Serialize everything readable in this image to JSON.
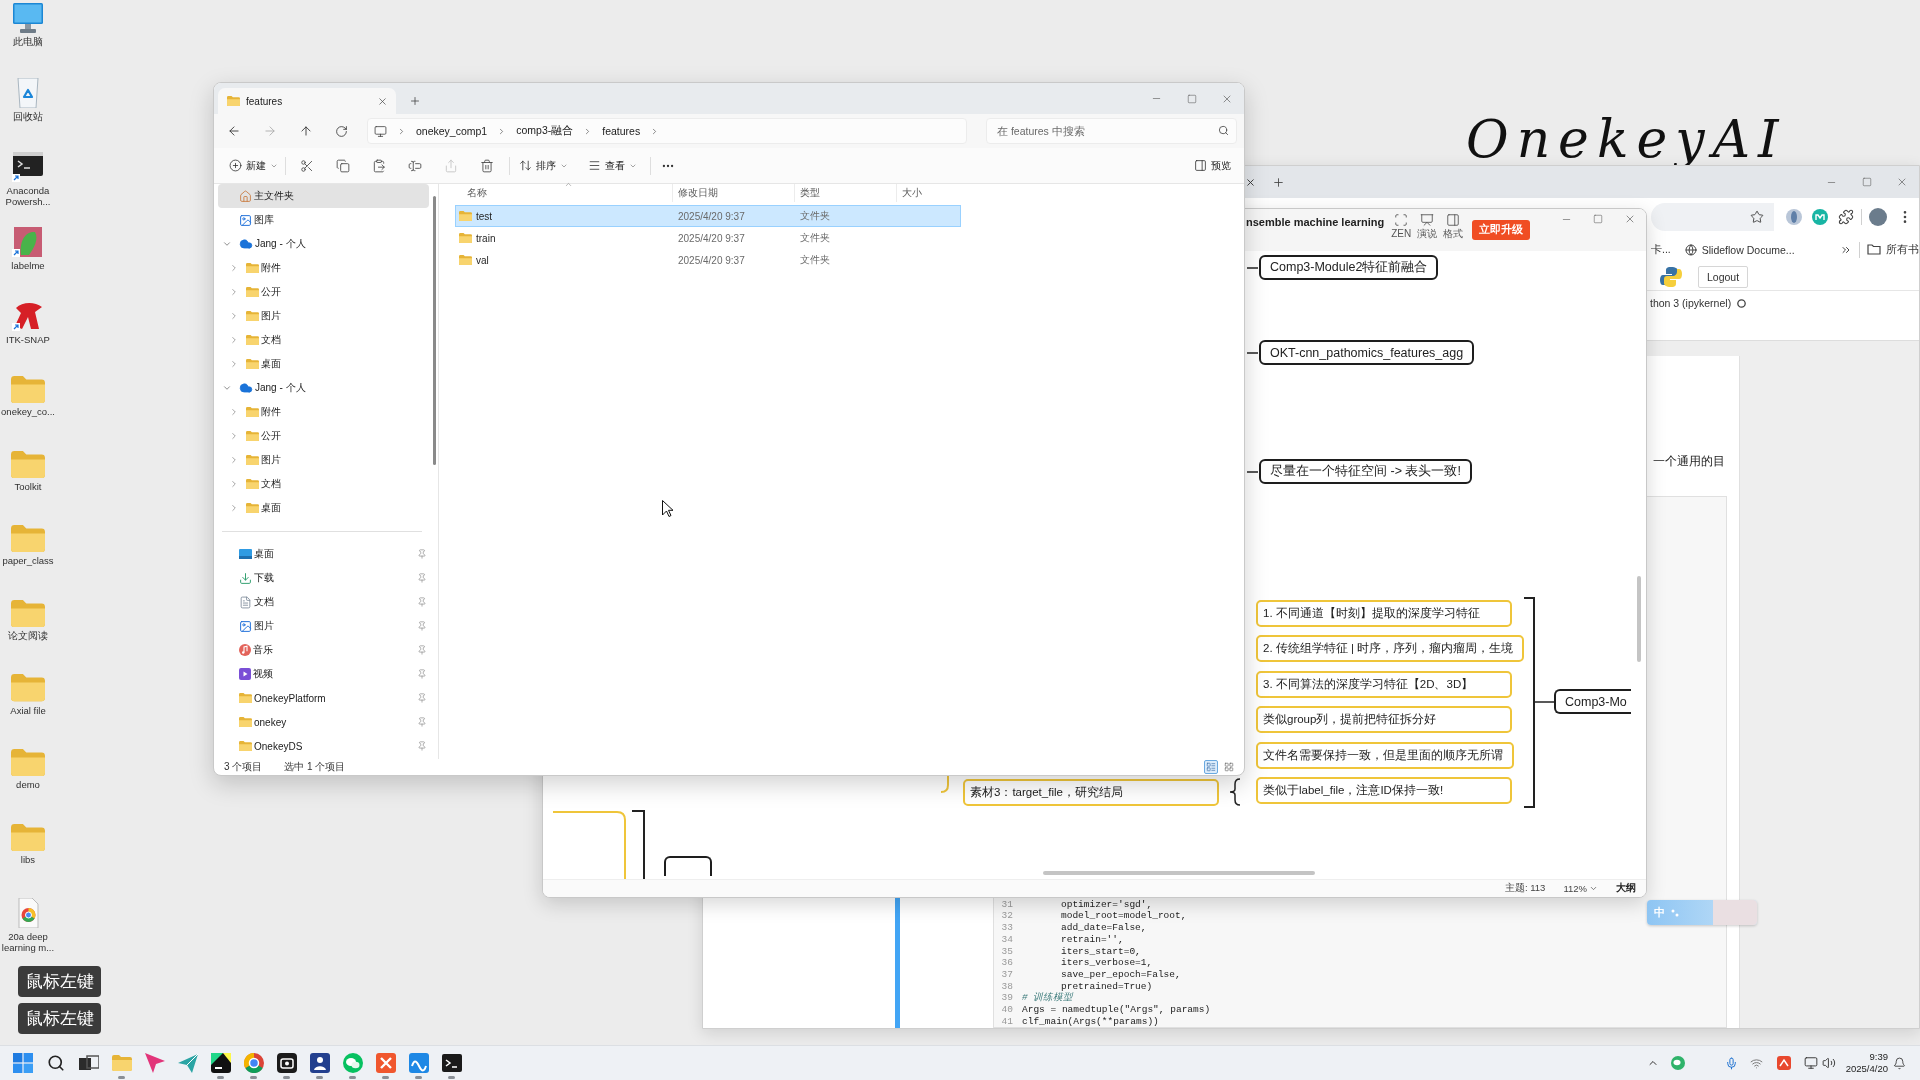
{
  "desktop": {
    "background_logo": "OnekeyAI",
    "icons": [
      {
        "label": "此电脑",
        "kind": "computer"
      },
      {
        "label": "回收站",
        "kind": "recycle"
      },
      {
        "label": "Anaconda Powersh...",
        "kind": "terminal"
      },
      {
        "label": "labelme",
        "kind": "labelme"
      },
      {
        "label": "ITK-SNAP",
        "kind": "snap"
      },
      {
        "label": "onekey_co...",
        "kind": "folder"
      },
      {
        "label": "Toolkit",
        "kind": "folder"
      },
      {
        "label": "paper_class",
        "kind": "folder"
      },
      {
        "label": "论文阅读",
        "kind": "folder"
      },
      {
        "label": "Axial file",
        "kind": "folder"
      },
      {
        "label": "demo",
        "kind": "folder"
      },
      {
        "label": "libs",
        "kind": "folder"
      },
      {
        "label": "20a deep learning m...",
        "kind": "pdf"
      }
    ],
    "key_captions": [
      "鼠标左键",
      "鼠标左键"
    ]
  },
  "explorer": {
    "tabs": [
      {
        "title": "features",
        "selected": true
      }
    ],
    "breadcrumbs": [
      "onekey_comp1",
      "comp3-融合",
      "features"
    ],
    "search_placeholder": "在 features 中搜索",
    "toolbar": {
      "new": "新建",
      "actions": [
        {
          "kind": "cut",
          "disabled": false
        },
        {
          "kind": "copy",
          "disabled": false
        },
        {
          "kind": "paste",
          "disabled": false
        },
        {
          "kind": "rename",
          "disabled": false
        },
        {
          "kind": "share",
          "disabled": true
        },
        {
          "kind": "delete",
          "disabled": false
        }
      ],
      "sort": "排序",
      "view": "查看",
      "preview": "预览"
    },
    "sidebar": {
      "items": [
        {
          "label": "主文件夹",
          "kind": "home",
          "selected": true
        },
        {
          "label": "图库",
          "kind": "gallery",
          "selected": false
        },
        {
          "label": "Jang - 个人",
          "kind": "cloud",
          "selected": false,
          "expanded": true,
          "children": [
            {
              "label": "附件",
              "kind": "folder",
              "selected": false,
              "expanded": false
            },
            {
              "label": "公开",
              "kind": "folder",
              "selected": false,
              "expanded": false
            },
            {
              "label": "图片",
              "kind": "folder",
              "selected": false,
              "expanded": false
            },
            {
              "label": "文档",
              "kind": "folder",
              "selected": false,
              "expanded": false
            },
            {
              "label": "桌面",
              "kind": "folder",
              "selected": false,
              "expanded": false
            }
          ]
        },
        {
          "label": "Jang - 个人",
          "kind": "cloud",
          "selected": false,
          "expanded": true,
          "children": [
            {
              "label": "附件",
              "kind": "folder",
              "selected": false,
              "expanded": false
            },
            {
              "label": "公开",
              "kind": "folder",
              "selected": false,
              "expanded": false
            },
            {
              "label": "图片",
              "kind": "folder",
              "selected": false,
              "expanded": false
            },
            {
              "label": "文档",
              "kind": "folder",
              "selected": false,
              "expanded": false
            },
            {
              "label": "桌面",
              "kind": "folder",
              "selected": false,
              "expanded": false
            }
          ]
        }
      ],
      "quick_access": [
        {
          "label": "桌面",
          "kind": "desktop",
          "selected": false,
          "pinned": true
        },
        {
          "label": "下载",
          "kind": "download",
          "selected": false,
          "pinned": true
        },
        {
          "label": "文档",
          "kind": "document",
          "selected": false,
          "pinned": true
        },
        {
          "label": "图片",
          "kind": "gallery",
          "selected": false,
          "pinned": true
        },
        {
          "label": "音乐",
          "kind": "music",
          "selected": false,
          "pinned": true
        },
        {
          "label": "视频",
          "kind": "video",
          "selected": false,
          "pinned": true
        },
        {
          "label": "OnekeyPlatform",
          "kind": "folder",
          "selected": false,
          "pinned": true
        },
        {
          "label": "onekey",
          "kind": "folder",
          "selected": false,
          "pinned": true
        },
        {
          "label": "OnekeyDS",
          "kind": "folder",
          "selected": false,
          "pinned": true
        }
      ]
    },
    "columns": [
      "名称",
      "修改日期",
      "类型",
      "大小"
    ],
    "rows": [
      {
        "name": "test",
        "modified": "2025/4/20 9:37",
        "type": "文件夹",
        "selected": true
      },
      {
        "name": "train",
        "modified": "2025/4/20 9:37",
        "type": "文件夹",
        "selected": false
      },
      {
        "name": "val",
        "modified": "2025/4/20 9:37",
        "type": "文件夹",
        "selected": false
      }
    ],
    "status": {
      "count": "3 个项目",
      "selection": "选中 1 个项目"
    },
    "view_modes": [
      {
        "kind": "details",
        "selected": true
      },
      {
        "kind": "tiles",
        "selected": false
      }
    ]
  },
  "mindmap": {
    "title": "nsemble machine learning",
    "tools": [
      {
        "label": "ZEN",
        "kind": "zen"
      },
      {
        "label": "演说",
        "kind": "present"
      },
      {
        "label": "格式",
        "kind": "format"
      }
    ],
    "upgrade": "立即升级",
    "nodes": [
      {
        "text": "Comp3-Module2特征前融合",
        "kind": "topic"
      },
      {
        "text": "OKT-cnn_pathomics_features_agg",
        "kind": "topic"
      },
      {
        "text": "尽量在一个特征空间 -> 表头一致!",
        "kind": "topic"
      },
      {
        "text": "1. 不同通道【时刻】提取的深度学习特征",
        "kind": "note"
      },
      {
        "text": "2. 传统组学特征 | 时序，序列，瘤内瘤周，生境",
        "kind": "note"
      },
      {
        "text": "3. 不同算法的深度学习特征【2D、3D】",
        "kind": "note"
      },
      {
        "text": "类似group列，提前把特征拆分好",
        "kind": "note"
      },
      {
        "text": "文件名需要保持一致，但是里面的顺序无所谓",
        "kind": "note"
      },
      {
        "text": "类似于label_file，注意ID保持一致!",
        "kind": "note"
      },
      {
        "text": "Comp3-Mo",
        "kind": "edge_topic"
      },
      {
        "text": "素材3：target_file，研究结局",
        "kind": "note"
      }
    ],
    "status": {
      "topics": "主题: 113",
      "zoom": "112%",
      "outline": "大纲"
    }
  },
  "browser": {
    "bookmarks": [
      {
        "label": "卡...",
        "kind": "text"
      },
      {
        "label": "Slideflow Docume...",
        "kind": "site"
      }
    ],
    "all_bookmarks": "所有书",
    "logout": "Logout",
    "kernel": "thon 3 (ipykernel)",
    "notebook_text": "一个通用的目",
    "code_lines": [
      {
        "number": "31",
        "text": "optimizer='sgd',",
        "kind": "arg"
      },
      {
        "number": "32",
        "text": "model_root=model_root,",
        "kind": "arg"
      },
      {
        "number": "33",
        "text": "add_date=False,",
        "kind": "arg"
      },
      {
        "number": "34",
        "text": "retrain='',",
        "kind": "arg"
      },
      {
        "number": "35",
        "text": "iters_start=0,",
        "kind": "arg"
      },
      {
        "number": "36",
        "text": "iters_verbose=1,",
        "kind": "arg"
      },
      {
        "number": "37",
        "text": "save_per_epoch=False,",
        "kind": "arg"
      },
      {
        "number": "38",
        "text": "pretrained=True)",
        "kind": "arg"
      },
      {
        "number": "39",
        "text": "# 训练模型",
        "kind": "comment"
      },
      {
        "number": "40",
        "text": "Args = namedtuple(\"Args\", params)",
        "kind": "code"
      },
      {
        "number": "41",
        "text": "clf_main(Args(**params))",
        "kind": "code"
      }
    ]
  },
  "ime": {
    "mode": "中"
  },
  "taskbar": {
    "apps": [
      {
        "kind": "start",
        "running": false
      },
      {
        "kind": "search",
        "running": false
      },
      {
        "kind": "taskview",
        "running": false
      },
      {
        "kind": "folder",
        "running": true
      },
      {
        "kind": "arrow",
        "running": false
      },
      {
        "kind": "plane",
        "running": false
      },
      {
        "kind": "code",
        "running": true
      },
      {
        "kind": "ring",
        "running": true
      },
      {
        "kind": "camera",
        "running": true
      },
      {
        "kind": "figure",
        "running": true
      },
      {
        "kind": "chat",
        "running": true
      },
      {
        "kind": "cross",
        "running": true
      },
      {
        "kind": "wave",
        "running": true
      },
      {
        "kind": "terminal",
        "running": true
      }
    ],
    "time": "9:39",
    "date": "2025/4/20"
  }
}
